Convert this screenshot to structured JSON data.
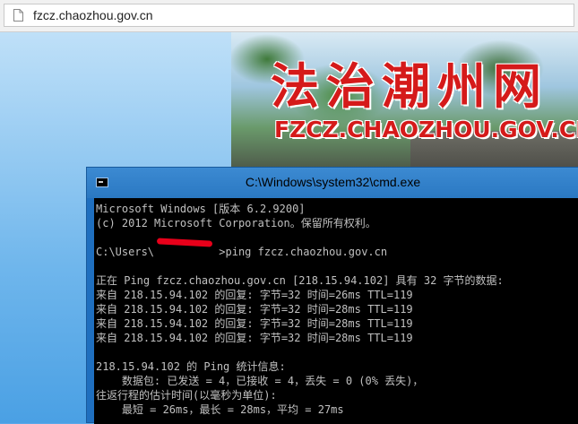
{
  "browser": {
    "url": "fzcz.chaozhou.gov.cn"
  },
  "banner": {
    "title": "法治潮州网",
    "subtitle": "FZCZ.CHAOZHOU.GOV.CN"
  },
  "cmd": {
    "window_title": "C:\\Windows\\system32\\cmd.exe",
    "lines": [
      "Microsoft Windows [版本 6.2.9200]",
      "(c) 2012 Microsoft Corporation。保留所有权利。",
      "",
      "C:\\Users\\          >ping fzcz.chaozhou.gov.cn",
      "",
      "正在 Ping fzcz.chaozhou.gov.cn [218.15.94.102] 具有 32 字节的数据:",
      "来自 218.15.94.102 的回复: 字节=32 时间=26ms TTL=119",
      "来自 218.15.94.102 的回复: 字节=32 时间=28ms TTL=119",
      "来自 218.15.94.102 的回复: 字节=32 时间=28ms TTL=119",
      "来自 218.15.94.102 的回复: 字节=32 时间=28ms TTL=119",
      "",
      "218.15.94.102 的 Ping 统计信息:",
      "    数据包: 已发送 = 4，已接收 = 4，丢失 = 0 (0% 丢失)，",
      "往返行程的估计时间(以毫秒为单位):",
      "    最短 = 26ms，最长 = 28ms，平均 = 27ms"
    ]
  },
  "colors": {
    "console_bg": "#000000",
    "console_text": "#c0c0c0",
    "titlebar": "#2a78c2",
    "banner_red": "#d51a1a"
  }
}
